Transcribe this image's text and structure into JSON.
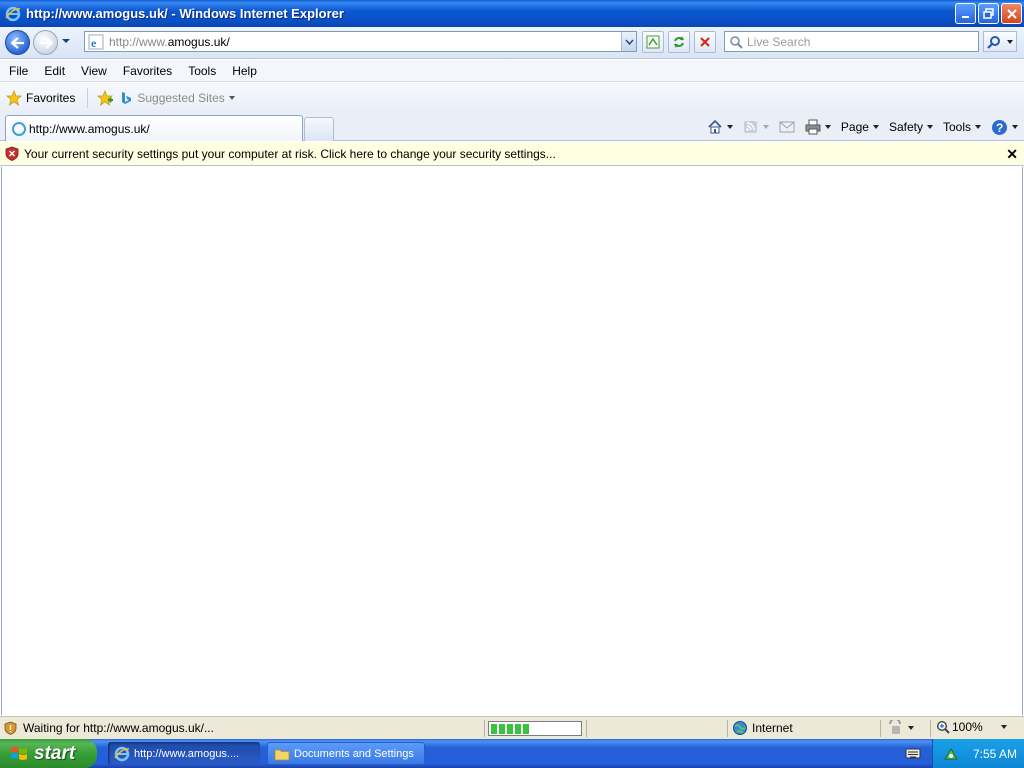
{
  "window": {
    "title": "http://www.amogus.uk/ - Windows Internet Explorer",
    "icon": "ie-icon"
  },
  "address_bar": {
    "url_dim": "http://www.",
    "url_main": "amogus.uk/"
  },
  "search": {
    "placeholder": "Live Search"
  },
  "menu": {
    "items": [
      "File",
      "Edit",
      "View",
      "Favorites",
      "Tools",
      "Help"
    ]
  },
  "favorites_bar": {
    "favorites_label": "Favorites",
    "suggested_sites_label": "Suggested Sites"
  },
  "tabs": {
    "active_label": "http://www.amogus.uk/"
  },
  "command_bar": {
    "page_label": "Page",
    "safety_label": "Safety",
    "tools_label": "Tools"
  },
  "info_bar": {
    "message": "Your current security settings put your computer at risk. Click here to change your security settings...",
    "close_label": "✕"
  },
  "status_bar": {
    "status_text": "Waiting for http://www.amogus.uk/...",
    "progress_blocks": 5,
    "zone_label": "Internet",
    "zoom_label": "100%"
  },
  "taskbar": {
    "start_label": "start",
    "items": [
      {
        "label": "http://www.amogus...."
      },
      {
        "label": "Documents and Settings"
      }
    ],
    "clock": "7:55 AM"
  },
  "colors": {
    "title_bar": "#0a58d2",
    "info_bar": "#ffffe1",
    "taskbar": "#245edb",
    "start_button": "#37a037"
  }
}
